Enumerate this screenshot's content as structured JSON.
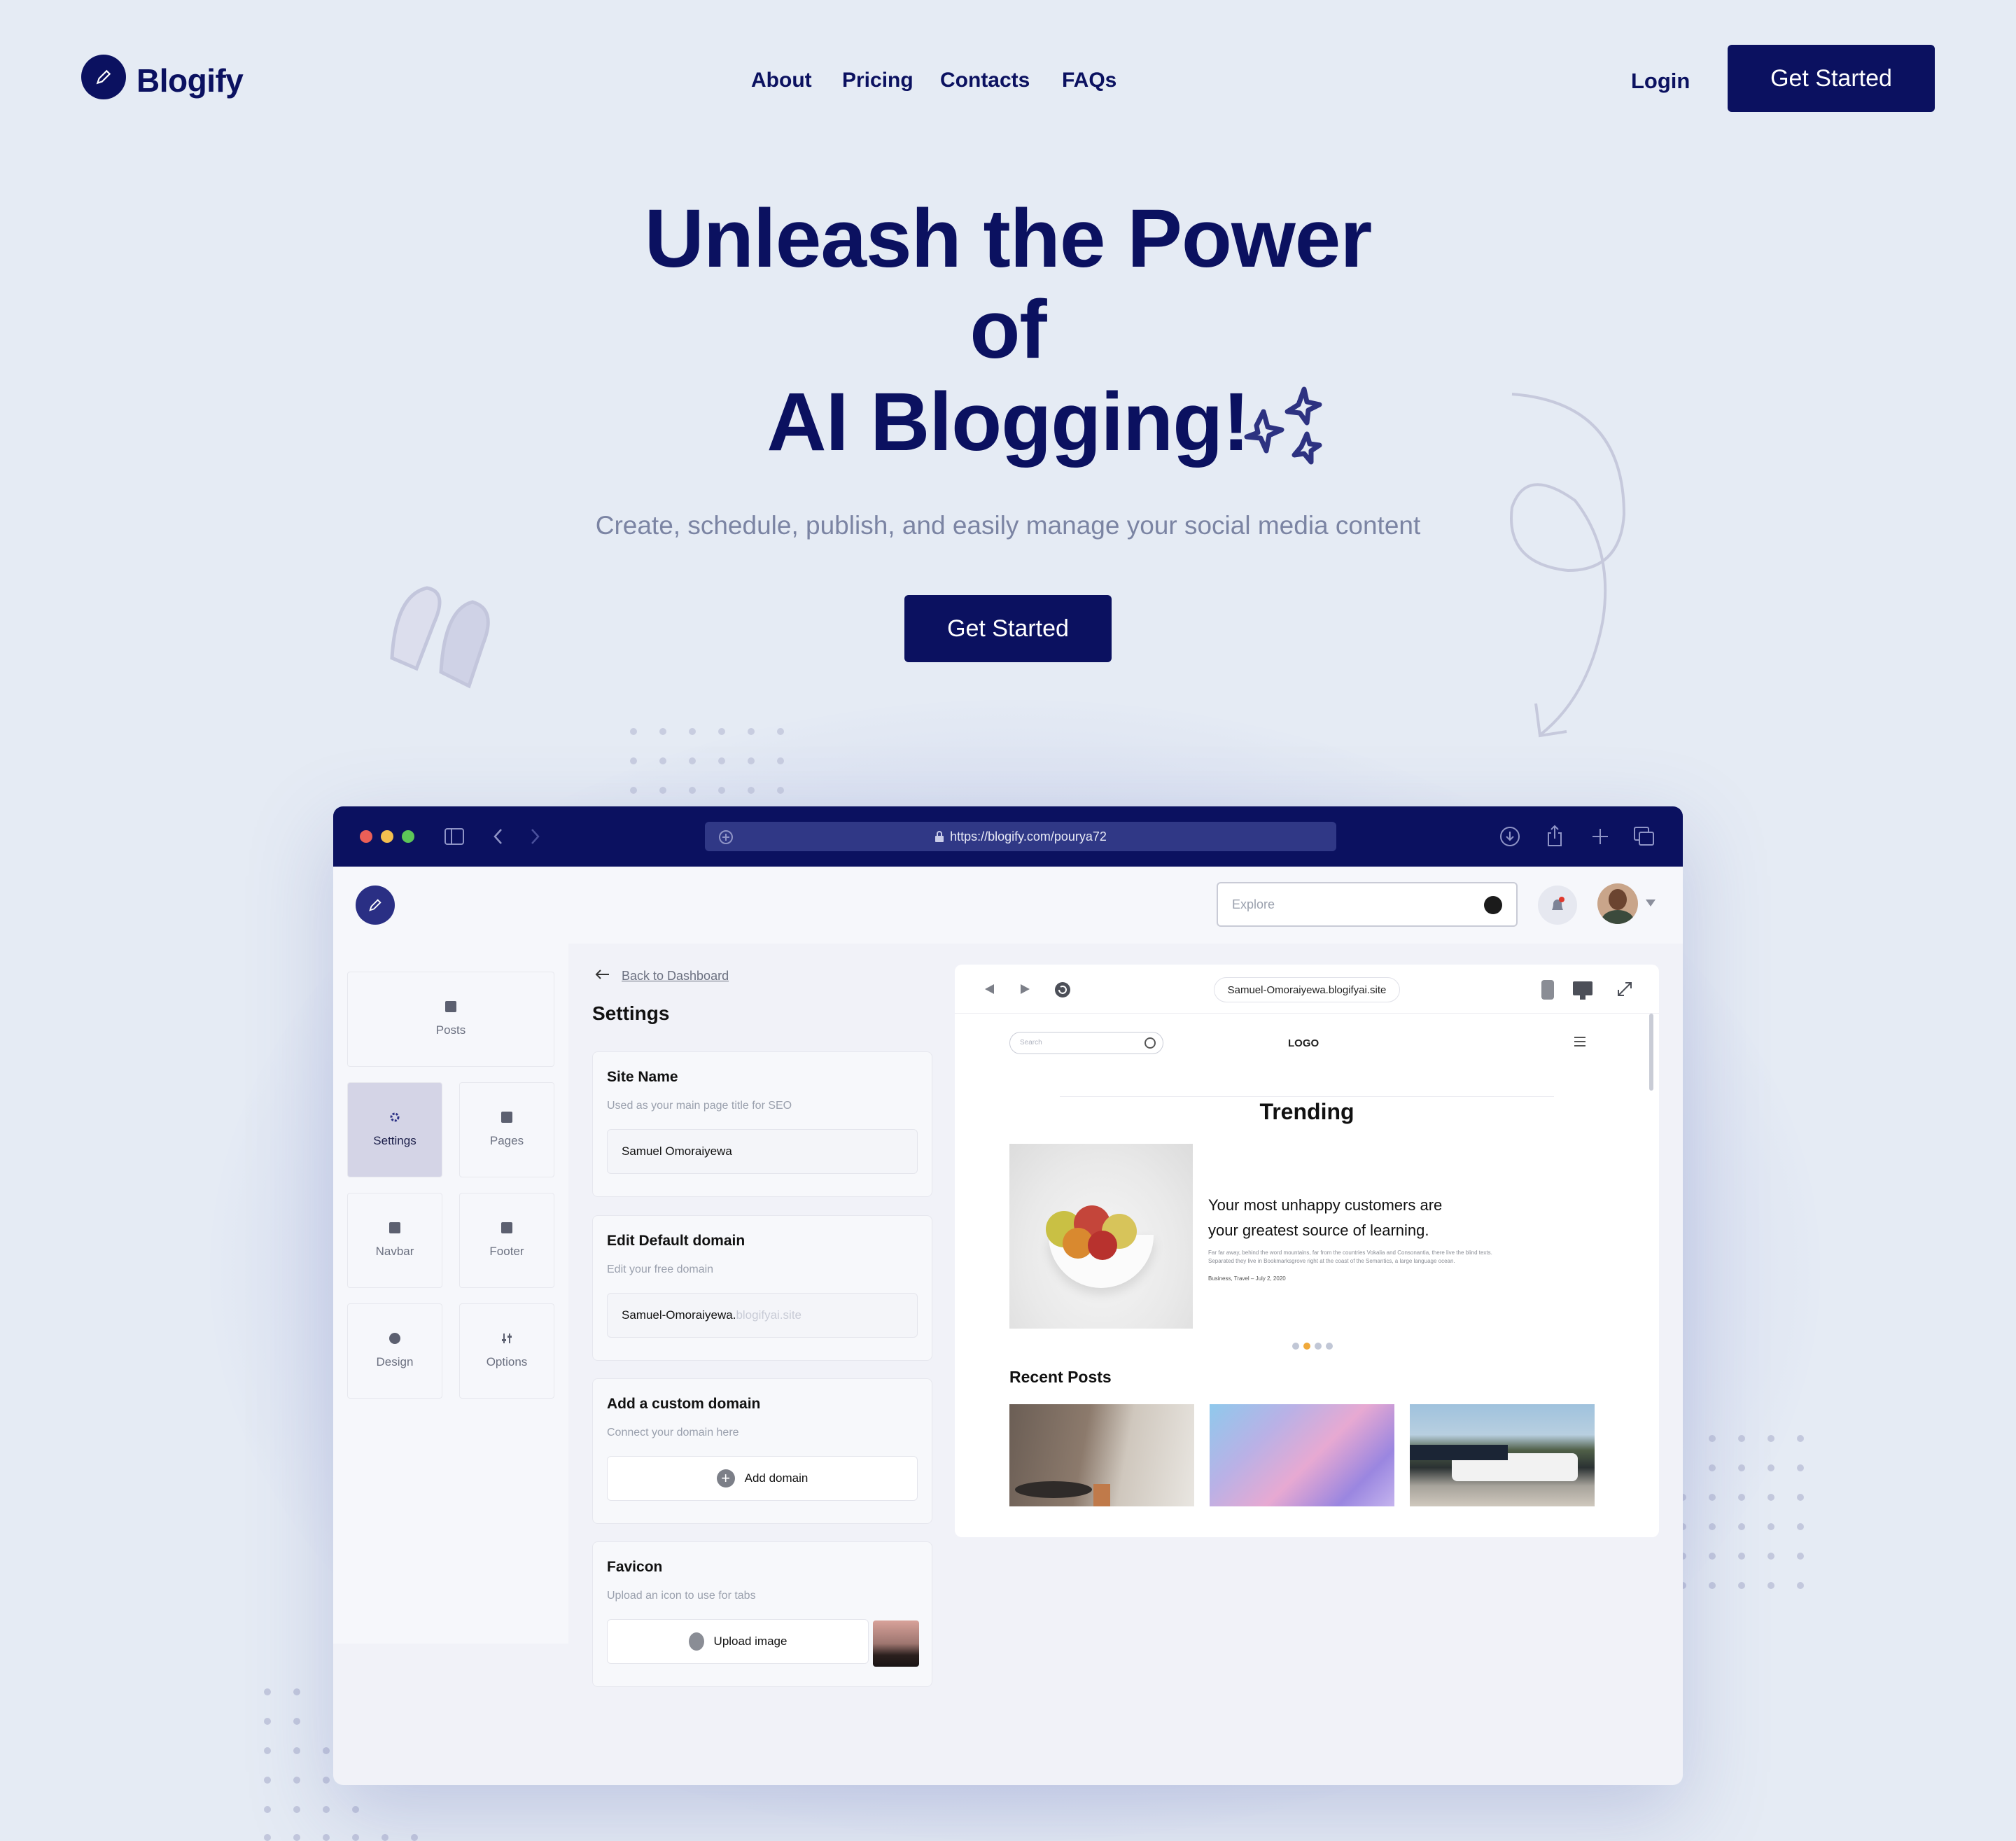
{
  "header": {
    "brand": "Blogify",
    "nav": [
      "About",
      "Pricing",
      "Contacts",
      "FAQs"
    ],
    "login": "Login",
    "cta": "Get Started"
  },
  "hero": {
    "line1": "Unleash the Power",
    "line2": "of",
    "line3": "AI Blogging!",
    "subtitle": "Create, schedule, publish, and easily manage your social media content",
    "cta": "Get Started"
  },
  "browser": {
    "url": "https://blogify.com/pourya72"
  },
  "app": {
    "search_placeholder": "Explore",
    "sidebar": [
      "Posts",
      "Settings",
      "Pages",
      "Navbar",
      "Footer",
      "Design",
      "Options"
    ],
    "back_link": "Back to Dashboard",
    "settings_title": "Settings",
    "site_name": {
      "title": "Site Name",
      "sub": "Used as your main page title for SEO",
      "value": "Samuel Omoraiyewa"
    },
    "domain": {
      "title": "Edit Default domain",
      "sub": "Edit your free domain",
      "value": "Samuel-Omoraiyewa.",
      "suffix": "blogifyai.site"
    },
    "custom": {
      "title": "Add a custom domain",
      "sub": "Connect your domain here",
      "button": "Add domain"
    },
    "favicon": {
      "title": "Favicon",
      "sub": "Upload an icon to use for tabs",
      "button": "Upload image"
    }
  },
  "preview": {
    "url": "Samuel-Omoraiyewa.blogifyai.site",
    "search": "Search",
    "logo": "LOGO",
    "trending": "Trending",
    "headline1": "Your most unhappy customers are",
    "headline2": "your greatest source of learning.",
    "body1": "Far far away, behind the word mountains, far from the countries Vokalia and Consonantia, there live the blind texts.",
    "body2": "Separated they live in Bookmarksgrove right at the coast of the Semantics, a large language ocean.",
    "meta": "Business, Travel  –  July 2, 2020",
    "recent": "Recent Posts"
  },
  "colors": {
    "brand": "#0b1160",
    "background": "#e5ebf4",
    "muted": "#7b84a3"
  }
}
